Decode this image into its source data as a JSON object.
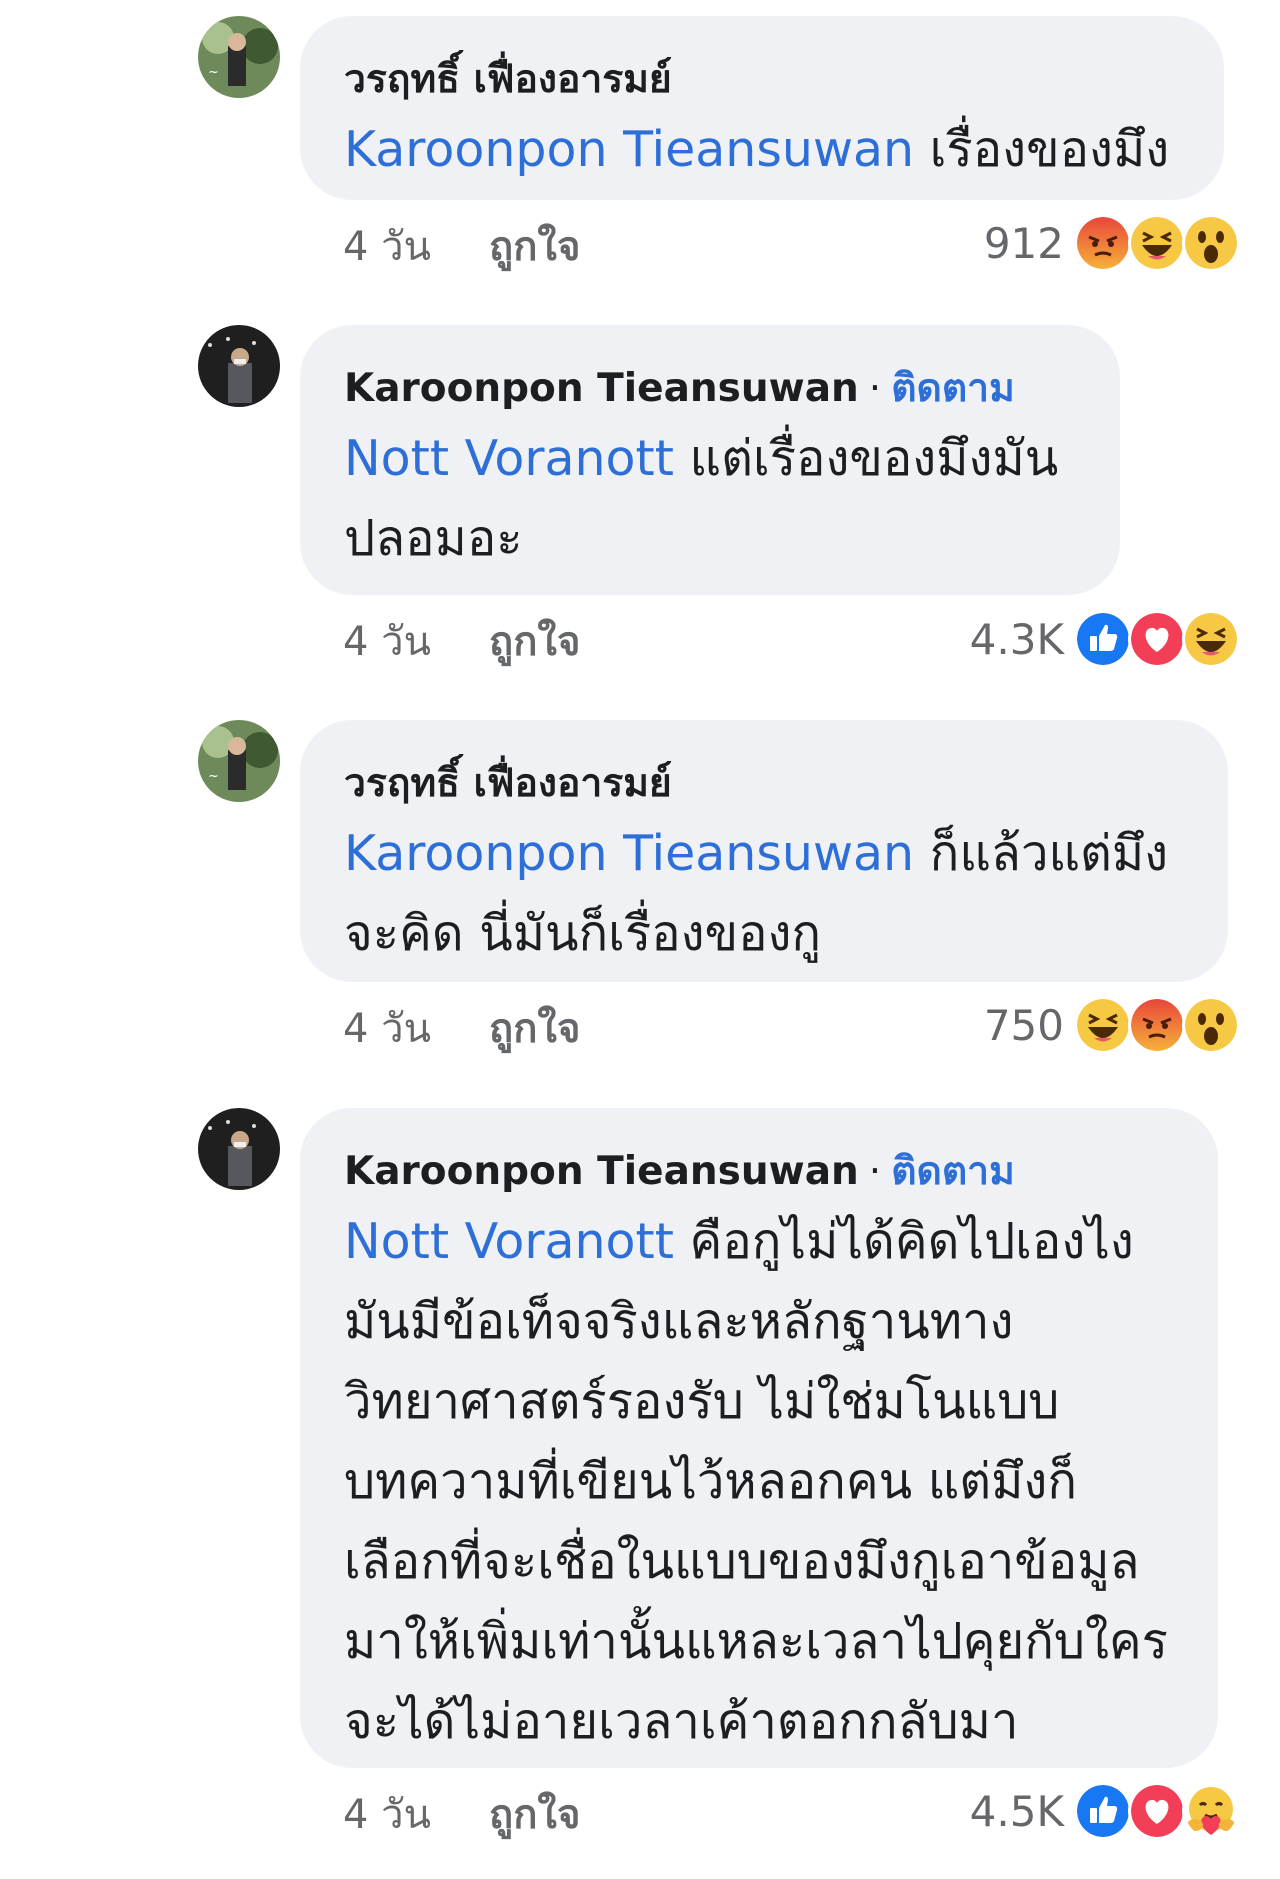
{
  "comments": [
    {
      "author": "วรฤทธิ์ เฟื่องอารมย์",
      "follow": "",
      "mention": "Karoonpon Tieansuwan",
      "text": " เรื่องของมึง",
      "time": "4 วัน",
      "like": "ถูกใจ",
      "count": "912",
      "reactions": [
        "angry-icon",
        "haha-icon",
        "wow-icon"
      ]
    },
    {
      "author": "Karoonpon Tieansuwan",
      "follow": "ติดตาม",
      "mention": "Nott Voranott",
      "text": " แต่เรื่องของมึงมันปลอมอะ",
      "time": "4 วัน",
      "like": "ถูกใจ",
      "count": "4.3K",
      "reactions": [
        "like-icon",
        "love-icon",
        "haha-icon"
      ]
    },
    {
      "author": "วรฤทธิ์ เฟื่องอารมย์",
      "follow": "",
      "mention": "Karoonpon Tieansuwan",
      "text": " ก็แล้วแต่มึงจะคิด นี่มันก็เรื่องของกู",
      "time": "4 วัน",
      "like": "ถูกใจ",
      "count": "750",
      "reactions": [
        "haha-icon",
        "angry-icon",
        "wow-icon"
      ]
    },
    {
      "author": "Karoonpon Tieansuwan",
      "follow": "ติดตาม",
      "mention": "Nott Voranott",
      "text": " คือกูไม่ได้คิดไปเองไง มันมีข้อเท็จจริงและหลักฐานทางวิทยาศาสตร์รองรับ ไม่ใช่มโนแบบบทความที่เขียนไว้หลอกคน แต่มึงก็เลือกที่จะเชื่อในแบบของมึงกูเอาข้อมูลมาให้เพิ่มเท่านั้นแหละเวลาไปคุยกับใครจะได้ไม่อายเวลาเค้าตอกกลับมา",
      "time": "4 วัน",
      "like": "ถูกใจ",
      "count": "4.5K",
      "reactions": [
        "like-icon",
        "love-icon",
        "care-icon"
      ]
    }
  ]
}
